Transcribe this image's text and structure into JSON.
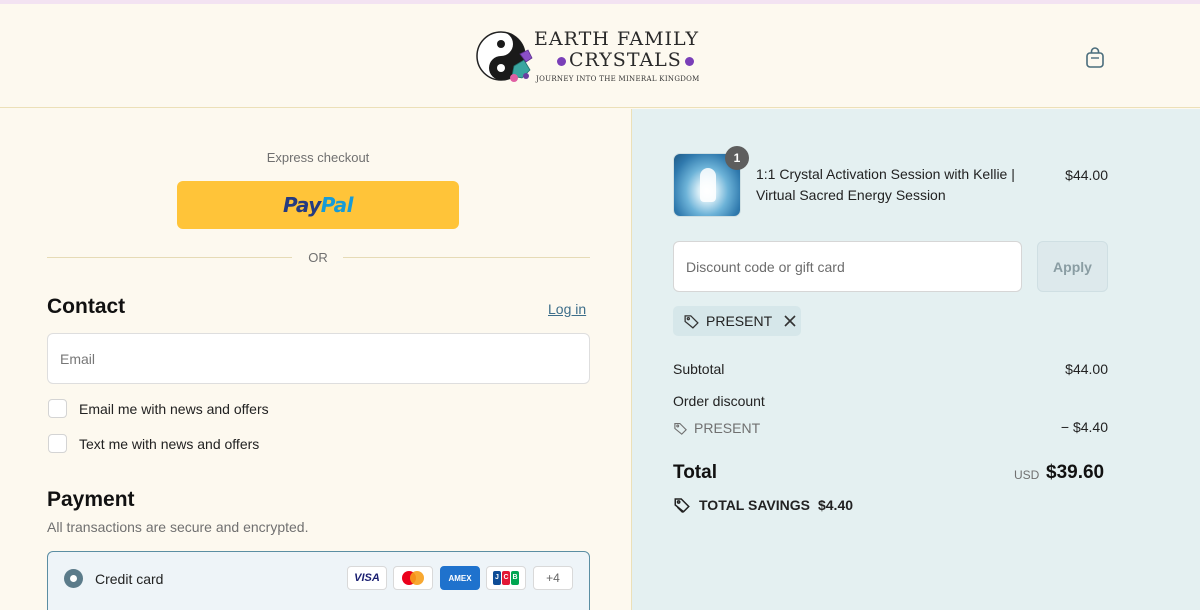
{
  "header": {
    "logo_line1": "EARTH FAMILY",
    "logo_line2": "CRYSTALS",
    "logo_tagline": "JOURNEY INTO THE MINERAL KINGDOM",
    "cart_icon": "shopping-bag-icon"
  },
  "express": {
    "label": "Express checkout",
    "paypal_a": "Pay",
    "paypal_b": "Pal",
    "or": "OR"
  },
  "contact": {
    "heading": "Contact",
    "login": "Log in",
    "email_placeholder": "Email",
    "news_email": "Email me with news and offers",
    "news_text": "Text me with news and offers"
  },
  "payment": {
    "heading": "Payment",
    "subtitle": "All transactions are secure and encrypted.",
    "method": "Credit card",
    "cards": [
      "VISA",
      "AMEX",
      "+4"
    ],
    "jcb": [
      "J",
      "C",
      "B"
    ]
  },
  "order": {
    "quantity": "1",
    "product": "1:1 Crystal Activation Session with Kellie | Virtual Sacred Energy Session",
    "price": "$44.00",
    "discount_placeholder": "Discount code or gift card",
    "apply": "Apply",
    "applied_code": "PRESENT",
    "subtotal_label": "Subtotal",
    "subtotal": "$44.00",
    "order_discount_label": "Order discount",
    "discount_code": "PRESENT",
    "discount_amount": "− $4.40",
    "total_label": "Total",
    "currency": "USD",
    "total": "$39.60",
    "savings_label": "TOTAL SAVINGS",
    "savings": "$4.40"
  },
  "colors": {
    "page_bg": "#fdf9ef",
    "summary_bg": "#e4f0f1",
    "paypal_yellow": "#ffc439",
    "link": "#3d6e8a"
  }
}
